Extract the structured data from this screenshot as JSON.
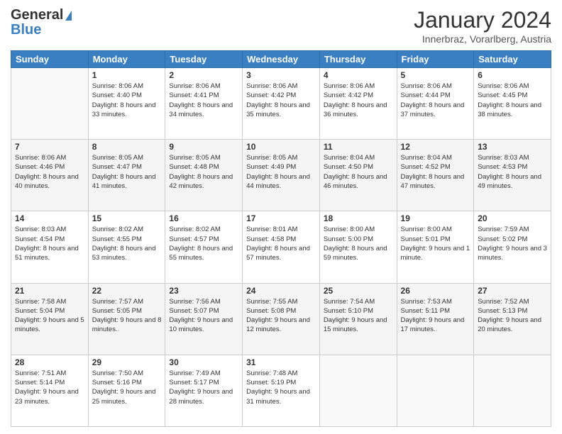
{
  "header": {
    "logo_general": "General",
    "logo_blue": "Blue",
    "month_title": "January 2024",
    "subtitle": "Innerbraz, Vorarlberg, Austria"
  },
  "days_of_week": [
    "Sunday",
    "Monday",
    "Tuesday",
    "Wednesday",
    "Thursday",
    "Friday",
    "Saturday"
  ],
  "weeks": [
    [
      {
        "day": "",
        "empty": true
      },
      {
        "day": "1",
        "sunrise": "8:06 AM",
        "sunset": "4:40 PM",
        "daylight": "8 hours and 33 minutes."
      },
      {
        "day": "2",
        "sunrise": "8:06 AM",
        "sunset": "4:41 PM",
        "daylight": "8 hours and 34 minutes."
      },
      {
        "day": "3",
        "sunrise": "8:06 AM",
        "sunset": "4:42 PM",
        "daylight": "8 hours and 35 minutes."
      },
      {
        "day": "4",
        "sunrise": "8:06 AM",
        "sunset": "4:42 PM",
        "daylight": "8 hours and 36 minutes."
      },
      {
        "day": "5",
        "sunrise": "8:06 AM",
        "sunset": "4:44 PM",
        "daylight": "8 hours and 37 minutes."
      },
      {
        "day": "6",
        "sunrise": "8:06 AM",
        "sunset": "4:45 PM",
        "daylight": "8 hours and 38 minutes."
      }
    ],
    [
      {
        "day": "7",
        "sunrise": "8:06 AM",
        "sunset": "4:46 PM",
        "daylight": "8 hours and 40 minutes."
      },
      {
        "day": "8",
        "sunrise": "8:05 AM",
        "sunset": "4:47 PM",
        "daylight": "8 hours and 41 minutes."
      },
      {
        "day": "9",
        "sunrise": "8:05 AM",
        "sunset": "4:48 PM",
        "daylight": "8 hours and 42 minutes."
      },
      {
        "day": "10",
        "sunrise": "8:05 AM",
        "sunset": "4:49 PM",
        "daylight": "8 hours and 44 minutes."
      },
      {
        "day": "11",
        "sunrise": "8:04 AM",
        "sunset": "4:50 PM",
        "daylight": "8 hours and 46 minutes."
      },
      {
        "day": "12",
        "sunrise": "8:04 AM",
        "sunset": "4:52 PM",
        "daylight": "8 hours and 47 minutes."
      },
      {
        "day": "13",
        "sunrise": "8:03 AM",
        "sunset": "4:53 PM",
        "daylight": "8 hours and 49 minutes."
      }
    ],
    [
      {
        "day": "14",
        "sunrise": "8:03 AM",
        "sunset": "4:54 PM",
        "daylight": "8 hours and 51 minutes."
      },
      {
        "day": "15",
        "sunrise": "8:02 AM",
        "sunset": "4:55 PM",
        "daylight": "8 hours and 53 minutes."
      },
      {
        "day": "16",
        "sunrise": "8:02 AM",
        "sunset": "4:57 PM",
        "daylight": "8 hours and 55 minutes."
      },
      {
        "day": "17",
        "sunrise": "8:01 AM",
        "sunset": "4:58 PM",
        "daylight": "8 hours and 57 minutes."
      },
      {
        "day": "18",
        "sunrise": "8:00 AM",
        "sunset": "5:00 PM",
        "daylight": "8 hours and 59 minutes."
      },
      {
        "day": "19",
        "sunrise": "8:00 AM",
        "sunset": "5:01 PM",
        "daylight": "9 hours and 1 minute."
      },
      {
        "day": "20",
        "sunrise": "7:59 AM",
        "sunset": "5:02 PM",
        "daylight": "9 hours and 3 minutes."
      }
    ],
    [
      {
        "day": "21",
        "sunrise": "7:58 AM",
        "sunset": "5:04 PM",
        "daylight": "9 hours and 5 minutes."
      },
      {
        "day": "22",
        "sunrise": "7:57 AM",
        "sunset": "5:05 PM",
        "daylight": "9 hours and 8 minutes."
      },
      {
        "day": "23",
        "sunrise": "7:56 AM",
        "sunset": "5:07 PM",
        "daylight": "9 hours and 10 minutes."
      },
      {
        "day": "24",
        "sunrise": "7:55 AM",
        "sunset": "5:08 PM",
        "daylight": "9 hours and 12 minutes."
      },
      {
        "day": "25",
        "sunrise": "7:54 AM",
        "sunset": "5:10 PM",
        "daylight": "9 hours and 15 minutes."
      },
      {
        "day": "26",
        "sunrise": "7:53 AM",
        "sunset": "5:11 PM",
        "daylight": "9 hours and 17 minutes."
      },
      {
        "day": "27",
        "sunrise": "7:52 AM",
        "sunset": "5:13 PM",
        "daylight": "9 hours and 20 minutes."
      }
    ],
    [
      {
        "day": "28",
        "sunrise": "7:51 AM",
        "sunset": "5:14 PM",
        "daylight": "9 hours and 23 minutes."
      },
      {
        "day": "29",
        "sunrise": "7:50 AM",
        "sunset": "5:16 PM",
        "daylight": "9 hours and 25 minutes."
      },
      {
        "day": "30",
        "sunrise": "7:49 AM",
        "sunset": "5:17 PM",
        "daylight": "9 hours and 28 minutes."
      },
      {
        "day": "31",
        "sunrise": "7:48 AM",
        "sunset": "5:19 PM",
        "daylight": "9 hours and 31 minutes."
      },
      {
        "day": "",
        "empty": true
      },
      {
        "day": "",
        "empty": true
      },
      {
        "day": "",
        "empty": true
      }
    ]
  ]
}
